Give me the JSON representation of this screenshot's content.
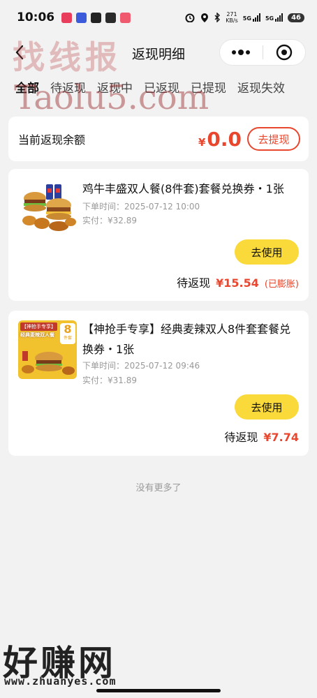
{
  "status": {
    "time": "10:06",
    "net_speed": "271",
    "net_unit": "KB/s",
    "sig1": "5G",
    "sig2": "5G",
    "battery": "46"
  },
  "nav": {
    "title": "返现明细"
  },
  "tabs": [
    {
      "label": "全部",
      "active": true
    },
    {
      "label": "待返现"
    },
    {
      "label": "返现中"
    },
    {
      "label": "已返现"
    },
    {
      "label": "已提现"
    },
    {
      "label": "返现失效"
    }
  ],
  "balance": {
    "label": "当前返现余额",
    "currency": "¥",
    "amount": "0.0",
    "withdraw_label": "去提现"
  },
  "orders": [
    {
      "title": "鸡牛丰盛双人餐(8件套)套餐兑换券・1张",
      "order_time": "下单时间：2025-07-12 10:00",
      "paid": "实付：¥32.89",
      "use_label": "去使用",
      "rebate_label": "待返现",
      "rebate_amount": "¥15.54",
      "rebate_note": "(已膨胀)"
    },
    {
      "title": "【神抢手专享】经典麦辣双人8件套套餐兑换券・1张",
      "order_time": "下单时间：2025-07-12 09:46",
      "paid": "实付：¥31.89",
      "use_label": "去使用",
      "rebate_label": "待返现",
      "rebate_amount": "¥7.74",
      "thumb_label": "【神抢手专享】",
      "thumb_sub": "经典麦辣双人餐",
      "thumb_badge": "8",
      "thumb_badge_unit": "件套"
    }
  ],
  "footer": {
    "no_more": "没有更多了"
  },
  "watermarks": {
    "top": "找线报",
    "site": "Taolu5.com",
    "bottom": "好赚网",
    "url": "www.zhuanyes.com"
  },
  "colors": {
    "accent": "#e8472e",
    "button_yellow": "#fad93a",
    "background": "#f2f2f2"
  }
}
